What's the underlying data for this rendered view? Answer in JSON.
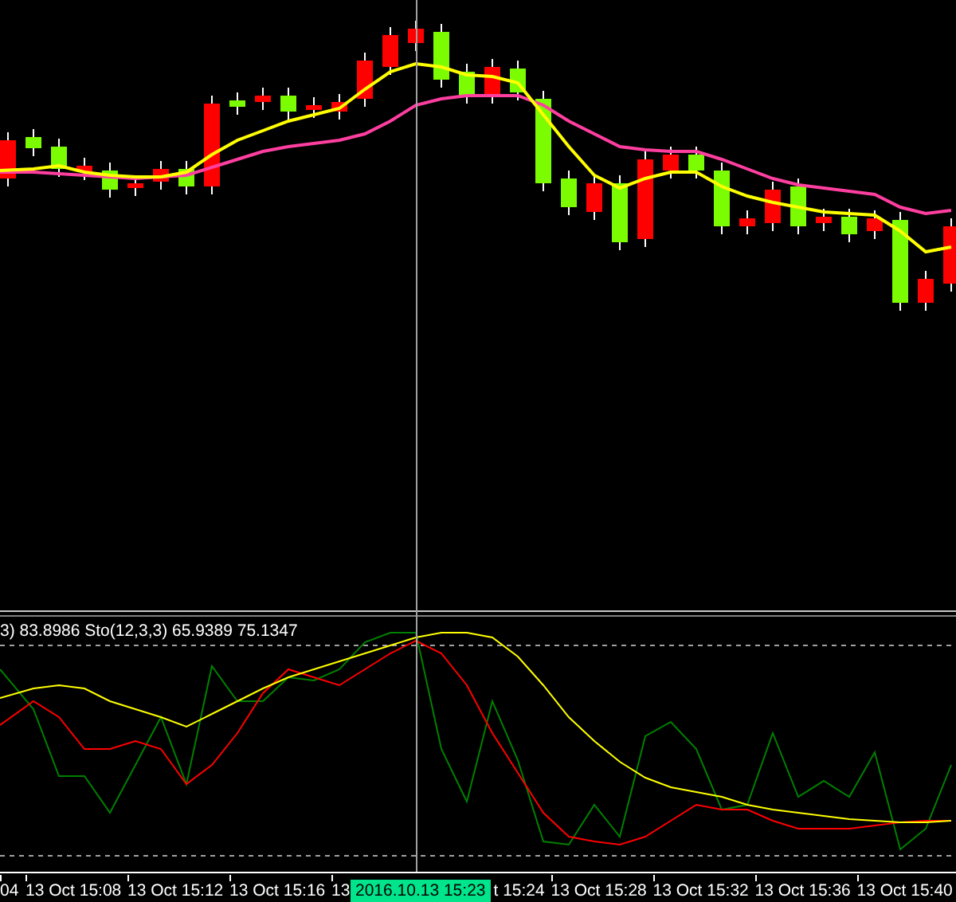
{
  "indicator_window": {
    "label": "3) 83.8986  Sto(12,3,3) 65.9389 75.1347"
  },
  "time_axis": {
    "labels_before": [
      "04",
      "13 Oct 15:08",
      "13 Oct 15:12",
      "13 Oct 15:16",
      "13"
    ],
    "crosshair_time": "2016.10.13 15:23",
    "labels_after": [
      "t 15:24",
      "13 Oct 15:28",
      "13 Oct 15:32",
      "13 Oct 15:36",
      "13 Oct 15:40"
    ]
  }
}
